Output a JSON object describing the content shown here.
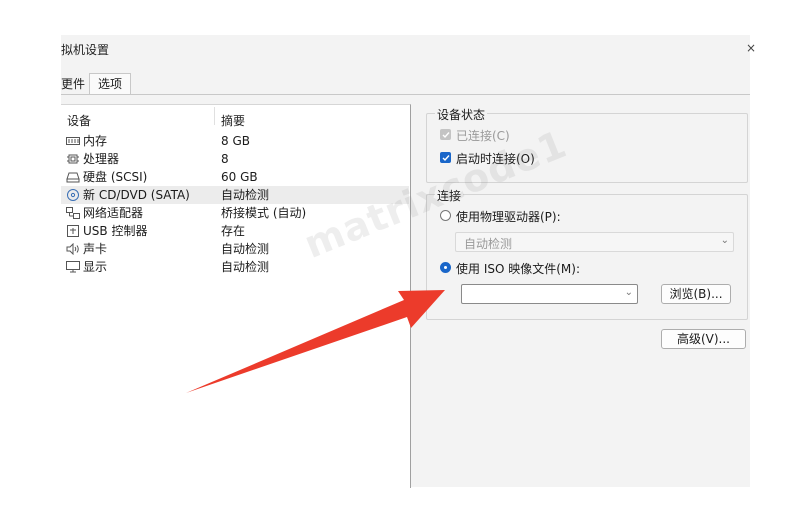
{
  "window": {
    "title": "拟机设置",
    "close": "×"
  },
  "tabs": [
    {
      "label": "更件"
    },
    {
      "label": "选项"
    }
  ],
  "device_list": {
    "columns": [
      "设备",
      "摘要"
    ],
    "rows": [
      {
        "name": "内存",
        "summary": "8 GB",
        "icon": "memory-icon"
      },
      {
        "name": "处理器",
        "summary": "8",
        "icon": "processor-icon"
      },
      {
        "name": "硬盘 (SCSI)",
        "summary": "60 GB",
        "icon": "harddisk-icon"
      },
      {
        "name": "新 CD/DVD (SATA)",
        "summary": "自动检测",
        "icon": "cdrom-icon",
        "selected": true
      },
      {
        "name": "网络适配器",
        "summary": "桥接模式 (自动)",
        "icon": "network-icon"
      },
      {
        "name": "USB 控制器",
        "summary": "存在",
        "icon": "usb-icon"
      },
      {
        "name": "声卡",
        "summary": "自动检测",
        "icon": "sound-icon"
      },
      {
        "name": "显示",
        "summary": "自动检测",
        "icon": "display-icon"
      }
    ]
  },
  "device_status": {
    "title": "设备状态",
    "connected": {
      "label": "已连接(C)",
      "checked": true,
      "disabled": true
    },
    "connect_at_power_on": {
      "label": "启动时连接(O)",
      "checked": true
    }
  },
  "connection": {
    "title": "连接",
    "physical": {
      "label": "使用物理驱动器(P):",
      "selected": false,
      "value": "自动检测"
    },
    "iso": {
      "label": "使用 ISO 映像文件(M):",
      "selected": true,
      "value": "",
      "browse": "浏览(B)..."
    }
  },
  "advanced_button": "高级(V)...",
  "watermark": "matrixcode1",
  "colors": {
    "accent": "#1a66c9",
    "arrow": "#ec3b2b"
  }
}
